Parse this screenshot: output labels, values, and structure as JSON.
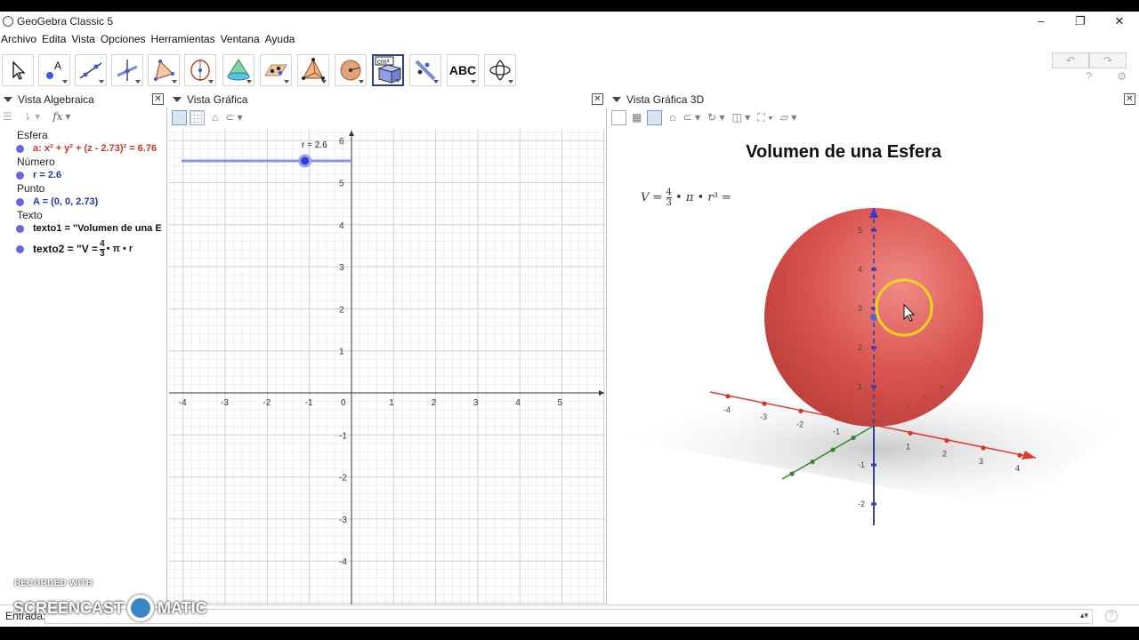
{
  "window": {
    "title": "GeoGebra Classic 5",
    "minimize": "–",
    "restore": "❐",
    "close": "✕"
  },
  "menu": [
    "Archivo",
    "Edita",
    "Vista",
    "Opciones",
    "Herramientas",
    "Ventana",
    "Ayuda"
  ],
  "toolbar": {
    "tools": [
      "move-tool",
      "point-tool",
      "line-tool",
      "perpendicular-tool",
      "polygon-tool",
      "circle-tool",
      "pyramid-tool",
      "conic-tool",
      "tetrahedron-tool",
      "sphere-tool",
      "volume-tool",
      "reflect-tool",
      "text-tool",
      "rotate-view-tool"
    ],
    "text_tool_label": "ABC",
    "volume_label": "cm³",
    "undo": "↶",
    "redo": "↷",
    "help": "?",
    "settings": "⚙"
  },
  "algebra_view": {
    "title": "Vista Algebraica",
    "fx": "fx",
    "categories": [
      {
        "name": "Esfera",
        "items": [
          {
            "text": "a: x² + y² + (z - 2.73)² = 6.76",
            "color": "#c0392b",
            "dot": "#6666dd"
          }
        ]
      },
      {
        "name": "Número",
        "items": [
          {
            "text": "r = 2.6",
            "color": "#2233aa",
            "dot": "#6666dd"
          }
        ]
      },
      {
        "name": "Punto",
        "items": [
          {
            "text": "A = (0, 0, 2.73)",
            "color": "#2233aa",
            "dot": "#6666dd"
          }
        ]
      },
      {
        "name": "Texto",
        "items": [
          {
            "text": "texto1 = \"Volumen de una E",
            "color": "#111",
            "dot": "#6666dd"
          },
          {
            "text": "texto2 = \"V = ",
            "color": "#111",
            "dot": "#6666dd"
          }
        ]
      }
    ]
  },
  "graphics_view": {
    "title": "Vista Gráfica",
    "slider_label": "r = 2.6",
    "slider_value": 2.6,
    "x_ticks": [
      "-4",
      "-3",
      "-2",
      "-1",
      "0",
      "1",
      "2",
      "3",
      "4",
      "5"
    ],
    "y_ticks": [
      "6",
      "5",
      "4",
      "3",
      "2",
      "1",
      "-1",
      "-2",
      "-3",
      "-4"
    ]
  },
  "graphics_3d_view": {
    "title": "Vista Gráfica 3D",
    "heading": "Volumen de una Esfera",
    "formula": "V = 4/3 • π • r³ =",
    "x_ticks": [
      "-4",
      "-3",
      "-2",
      "-1",
      "1",
      "2",
      "3",
      "4"
    ],
    "z_ticks": [
      "5",
      "4",
      "3",
      "2",
      "1",
      "-1",
      "-2"
    ],
    "sphere_color": "#d9534f"
  },
  "input_bar": {
    "label": "Entrada:",
    "spinner": "▴▾",
    "help": "?"
  },
  "watermark": {
    "line1": "RECORDED WITH",
    "line2a": "SCREENCAST",
    "line2b": "MATIC"
  }
}
